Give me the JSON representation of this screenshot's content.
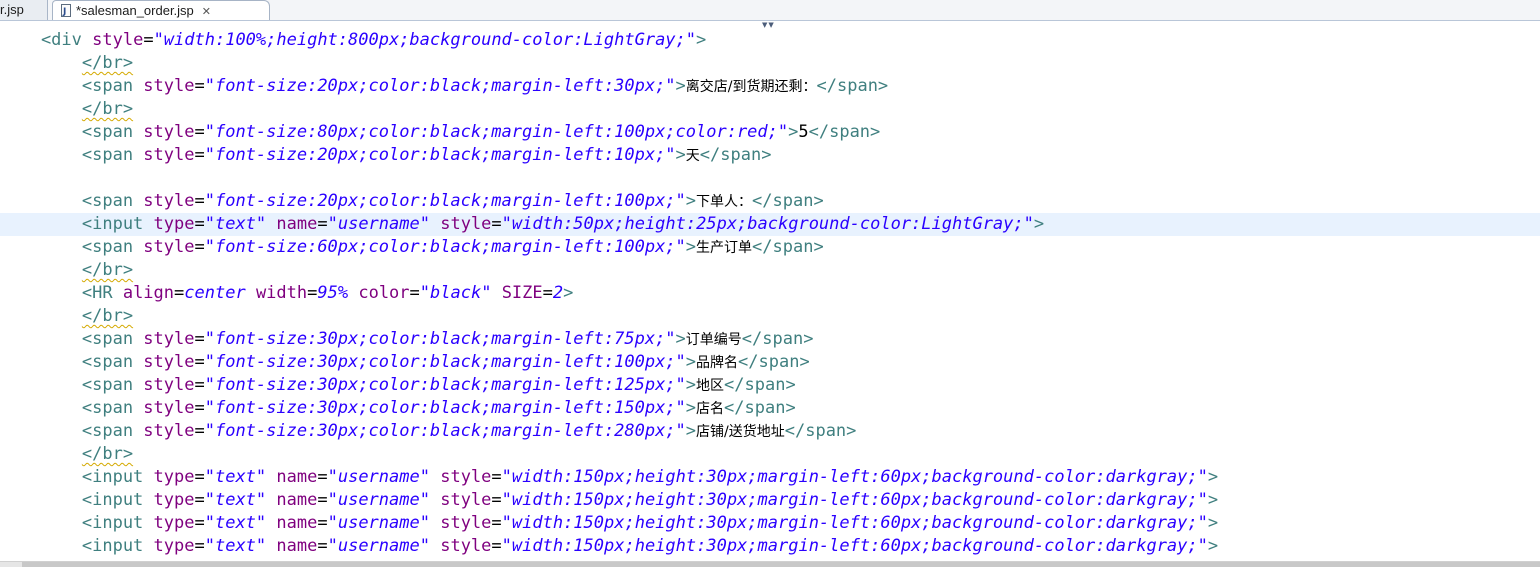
{
  "tabs": [
    {
      "label": "r.jsp",
      "active": false
    },
    {
      "label": "*salesman_order.jsp",
      "active": true
    }
  ],
  "editor": {
    "lines": [
      [
        {
          "t": "tag",
          "s": "    <div "
        },
        {
          "t": "attr",
          "s": "style"
        },
        {
          "t": "text",
          "s": "="
        },
        {
          "t": "val",
          "s": "\"width:100%;height:800px;background-color:LightGray;\""
        },
        {
          "t": "tag",
          "s": ">"
        }
      ],
      [
        {
          "t": "text",
          "s": "        "
        },
        {
          "t": "warn",
          "s": "</br>"
        }
      ],
      [
        {
          "t": "tag",
          "s": "        <span "
        },
        {
          "t": "attr",
          "s": "style"
        },
        {
          "t": "text",
          "s": "="
        },
        {
          "t": "val",
          "s": "\"font-size:20px;color:black;margin-left:30px;\""
        },
        {
          "t": "tag",
          "s": ">"
        },
        {
          "t": "cjk",
          "s": "离交店/到货期还剩："
        },
        {
          "t": "tag",
          "s": "</span>"
        }
      ],
      [
        {
          "t": "text",
          "s": "        "
        },
        {
          "t": "warn",
          "s": "</br>"
        }
      ],
      [
        {
          "t": "tag",
          "s": "        <span "
        },
        {
          "t": "attr",
          "s": "style"
        },
        {
          "t": "text",
          "s": "="
        },
        {
          "t": "val",
          "s": "\"font-size:80px;color:black;margin-left:100px;color:red;\""
        },
        {
          "t": "tag",
          "s": ">"
        },
        {
          "t": "text",
          "s": "5"
        },
        {
          "t": "tag",
          "s": "</span>"
        }
      ],
      [
        {
          "t": "tag",
          "s": "        <span "
        },
        {
          "t": "attr",
          "s": "style"
        },
        {
          "t": "text",
          "s": "="
        },
        {
          "t": "val",
          "s": "\"font-size:20px;color:black;margin-left:10px;\""
        },
        {
          "t": "tag",
          "s": ">"
        },
        {
          "t": "cjk",
          "s": "天"
        },
        {
          "t": "tag",
          "s": "</span>"
        }
      ],
      [
        {
          "t": "text",
          "s": ""
        }
      ],
      [
        {
          "t": "tag",
          "s": "        <span "
        },
        {
          "t": "attr",
          "s": "style"
        },
        {
          "t": "text",
          "s": "="
        },
        {
          "t": "val",
          "s": "\"font-size:20px;color:black;margin-left:100px;\""
        },
        {
          "t": "tag",
          "s": ">"
        },
        {
          "t": "cjk",
          "s": "下单人："
        },
        {
          "t": "tag",
          "s": "</span>"
        }
      ],
      [
        {
          "t": "tag",
          "s": "        <input "
        },
        {
          "t": "attr",
          "s": "type"
        },
        {
          "t": "text",
          "s": "="
        },
        {
          "t": "val",
          "s": "\"text\""
        },
        {
          "t": "text",
          "s": " "
        },
        {
          "t": "attr",
          "s": "name"
        },
        {
          "t": "text",
          "s": "="
        },
        {
          "t": "val",
          "s": "\"username\""
        },
        {
          "t": "text",
          "s": " "
        },
        {
          "t": "attr",
          "s": "style"
        },
        {
          "t": "text",
          "s": "="
        },
        {
          "t": "val",
          "s": "\"width:50px;height:25px;background-color:LightGray;\""
        },
        {
          "t": "tag",
          "s": ">"
        }
      ],
      [
        {
          "t": "tag",
          "s": "        <span "
        },
        {
          "t": "attr",
          "s": "style"
        },
        {
          "t": "text",
          "s": "="
        },
        {
          "t": "val",
          "s": "\"font-size:60px;color:black;margin-left:100px;\""
        },
        {
          "t": "tag",
          "s": ">"
        },
        {
          "t": "cjk",
          "s": "生产订单"
        },
        {
          "t": "tag",
          "s": "</span>"
        }
      ],
      [
        {
          "t": "text",
          "s": "        "
        },
        {
          "t": "warn",
          "s": "</br>"
        }
      ],
      [
        {
          "t": "tag",
          "s": "        <HR "
        },
        {
          "t": "attr",
          "s": "align"
        },
        {
          "t": "text",
          "s": "="
        },
        {
          "t": "val",
          "s": "center"
        },
        {
          "t": "text",
          "s": " "
        },
        {
          "t": "attr",
          "s": "width"
        },
        {
          "t": "text",
          "s": "="
        },
        {
          "t": "val",
          "s": "95%"
        },
        {
          "t": "text",
          "s": " "
        },
        {
          "t": "attr",
          "s": "color"
        },
        {
          "t": "text",
          "s": "="
        },
        {
          "t": "val",
          "s": "\"black\""
        },
        {
          "t": "text",
          "s": " "
        },
        {
          "t": "attr",
          "s": "SIZE"
        },
        {
          "t": "text",
          "s": "="
        },
        {
          "t": "val",
          "s": "2"
        },
        {
          "t": "tag",
          "s": ">"
        }
      ],
      [
        {
          "t": "text",
          "s": "        "
        },
        {
          "t": "warn",
          "s": "</br>"
        }
      ],
      [
        {
          "t": "tag",
          "s": "        <span "
        },
        {
          "t": "attr",
          "s": "style"
        },
        {
          "t": "text",
          "s": "="
        },
        {
          "t": "val",
          "s": "\"font-size:30px;color:black;margin-left:75px;\""
        },
        {
          "t": "tag",
          "s": ">"
        },
        {
          "t": "cjk",
          "s": "订单编号"
        },
        {
          "t": "tag",
          "s": "</span>"
        }
      ],
      [
        {
          "t": "tag",
          "s": "        <span "
        },
        {
          "t": "attr",
          "s": "style"
        },
        {
          "t": "text",
          "s": "="
        },
        {
          "t": "val",
          "s": "\"font-size:30px;color:black;margin-left:100px;\""
        },
        {
          "t": "tag",
          "s": ">"
        },
        {
          "t": "cjk",
          "s": "品牌名"
        },
        {
          "t": "tag",
          "s": "</span>"
        }
      ],
      [
        {
          "t": "tag",
          "s": "        <span "
        },
        {
          "t": "attr",
          "s": "style"
        },
        {
          "t": "text",
          "s": "="
        },
        {
          "t": "val",
          "s": "\"font-size:30px;color:black;margin-left:125px;\""
        },
        {
          "t": "tag",
          "s": ">"
        },
        {
          "t": "cjk",
          "s": "地区"
        },
        {
          "t": "tag",
          "s": "</span>"
        }
      ],
      [
        {
          "t": "tag",
          "s": "        <span "
        },
        {
          "t": "attr",
          "s": "style"
        },
        {
          "t": "text",
          "s": "="
        },
        {
          "t": "val",
          "s": "\"font-size:30px;color:black;margin-left:150px;\""
        },
        {
          "t": "tag",
          "s": ">"
        },
        {
          "t": "cjk",
          "s": "店名"
        },
        {
          "t": "tag",
          "s": "</span>"
        }
      ],
      [
        {
          "t": "tag",
          "s": "        <span "
        },
        {
          "t": "attr",
          "s": "style"
        },
        {
          "t": "text",
          "s": "="
        },
        {
          "t": "val",
          "s": "\"font-size:30px;color:black;margin-left:280px;\""
        },
        {
          "t": "tag",
          "s": ">"
        },
        {
          "t": "cjk",
          "s": "店铺/送货地址"
        },
        {
          "t": "tag",
          "s": "</span>"
        }
      ],
      [
        {
          "t": "text",
          "s": "        "
        },
        {
          "t": "warn",
          "s": "</br>"
        }
      ],
      [
        {
          "t": "tag",
          "s": "        <input "
        },
        {
          "t": "attr",
          "s": "type"
        },
        {
          "t": "text",
          "s": "="
        },
        {
          "t": "val",
          "s": "\"text\""
        },
        {
          "t": "text",
          "s": " "
        },
        {
          "t": "attr",
          "s": "name"
        },
        {
          "t": "text",
          "s": "="
        },
        {
          "t": "val",
          "s": "\"username\""
        },
        {
          "t": "text",
          "s": " "
        },
        {
          "t": "attr",
          "s": "style"
        },
        {
          "t": "text",
          "s": "="
        },
        {
          "t": "val",
          "s": "\"width:150px;height:30px;margin-left:60px;background-color:darkgray;\""
        },
        {
          "t": "tag",
          "s": ">"
        }
      ],
      [
        {
          "t": "tag",
          "s": "        <input "
        },
        {
          "t": "attr",
          "s": "type"
        },
        {
          "t": "text",
          "s": "="
        },
        {
          "t": "val",
          "s": "\"text\""
        },
        {
          "t": "text",
          "s": " "
        },
        {
          "t": "attr",
          "s": "name"
        },
        {
          "t": "text",
          "s": "="
        },
        {
          "t": "val",
          "s": "\"username\""
        },
        {
          "t": "text",
          "s": " "
        },
        {
          "t": "attr",
          "s": "style"
        },
        {
          "t": "text",
          "s": "="
        },
        {
          "t": "val",
          "s": "\"width:150px;height:30px;margin-left:60px;background-color:darkgray;\""
        },
        {
          "t": "tag",
          "s": ">"
        }
      ],
      [
        {
          "t": "tag",
          "s": "        <input "
        },
        {
          "t": "attr",
          "s": "type"
        },
        {
          "t": "text",
          "s": "="
        },
        {
          "t": "val",
          "s": "\"text\""
        },
        {
          "t": "text",
          "s": " "
        },
        {
          "t": "attr",
          "s": "name"
        },
        {
          "t": "text",
          "s": "="
        },
        {
          "t": "val",
          "s": "\"username\""
        },
        {
          "t": "text",
          "s": " "
        },
        {
          "t": "attr",
          "s": "style"
        },
        {
          "t": "text",
          "s": "="
        },
        {
          "t": "val",
          "s": "\"width:150px;height:30px;margin-left:60px;background-color:darkgray;\""
        },
        {
          "t": "tag",
          "s": ">"
        }
      ],
      [
        {
          "t": "tag",
          "s": "        <input "
        },
        {
          "t": "attr",
          "s": "type"
        },
        {
          "t": "text",
          "s": "="
        },
        {
          "t": "val",
          "s": "\"text\""
        },
        {
          "t": "text",
          "s": " "
        },
        {
          "t": "attr",
          "s": "name"
        },
        {
          "t": "text",
          "s": "="
        },
        {
          "t": "val",
          "s": "\"username\""
        },
        {
          "t": "text",
          "s": " "
        },
        {
          "t": "attr",
          "s": "style"
        },
        {
          "t": "text",
          "s": "="
        },
        {
          "t": "val",
          "s": "\"width:150px;height:30px;margin-left:60px;background-color:darkgray;\""
        },
        {
          "t": "tag",
          "s": ">"
        }
      ]
    ],
    "current_line": 8
  },
  "colors": {
    "tag": "#3f7f7f",
    "attr": "#7f007f",
    "value": "#2a00ff",
    "current_line_bg": "#e8f2fe"
  },
  "icons": {
    "tab_file": "jsp-file-icon",
    "tab_close": "close-icon",
    "tab_list": "chevron-down-icon"
  }
}
